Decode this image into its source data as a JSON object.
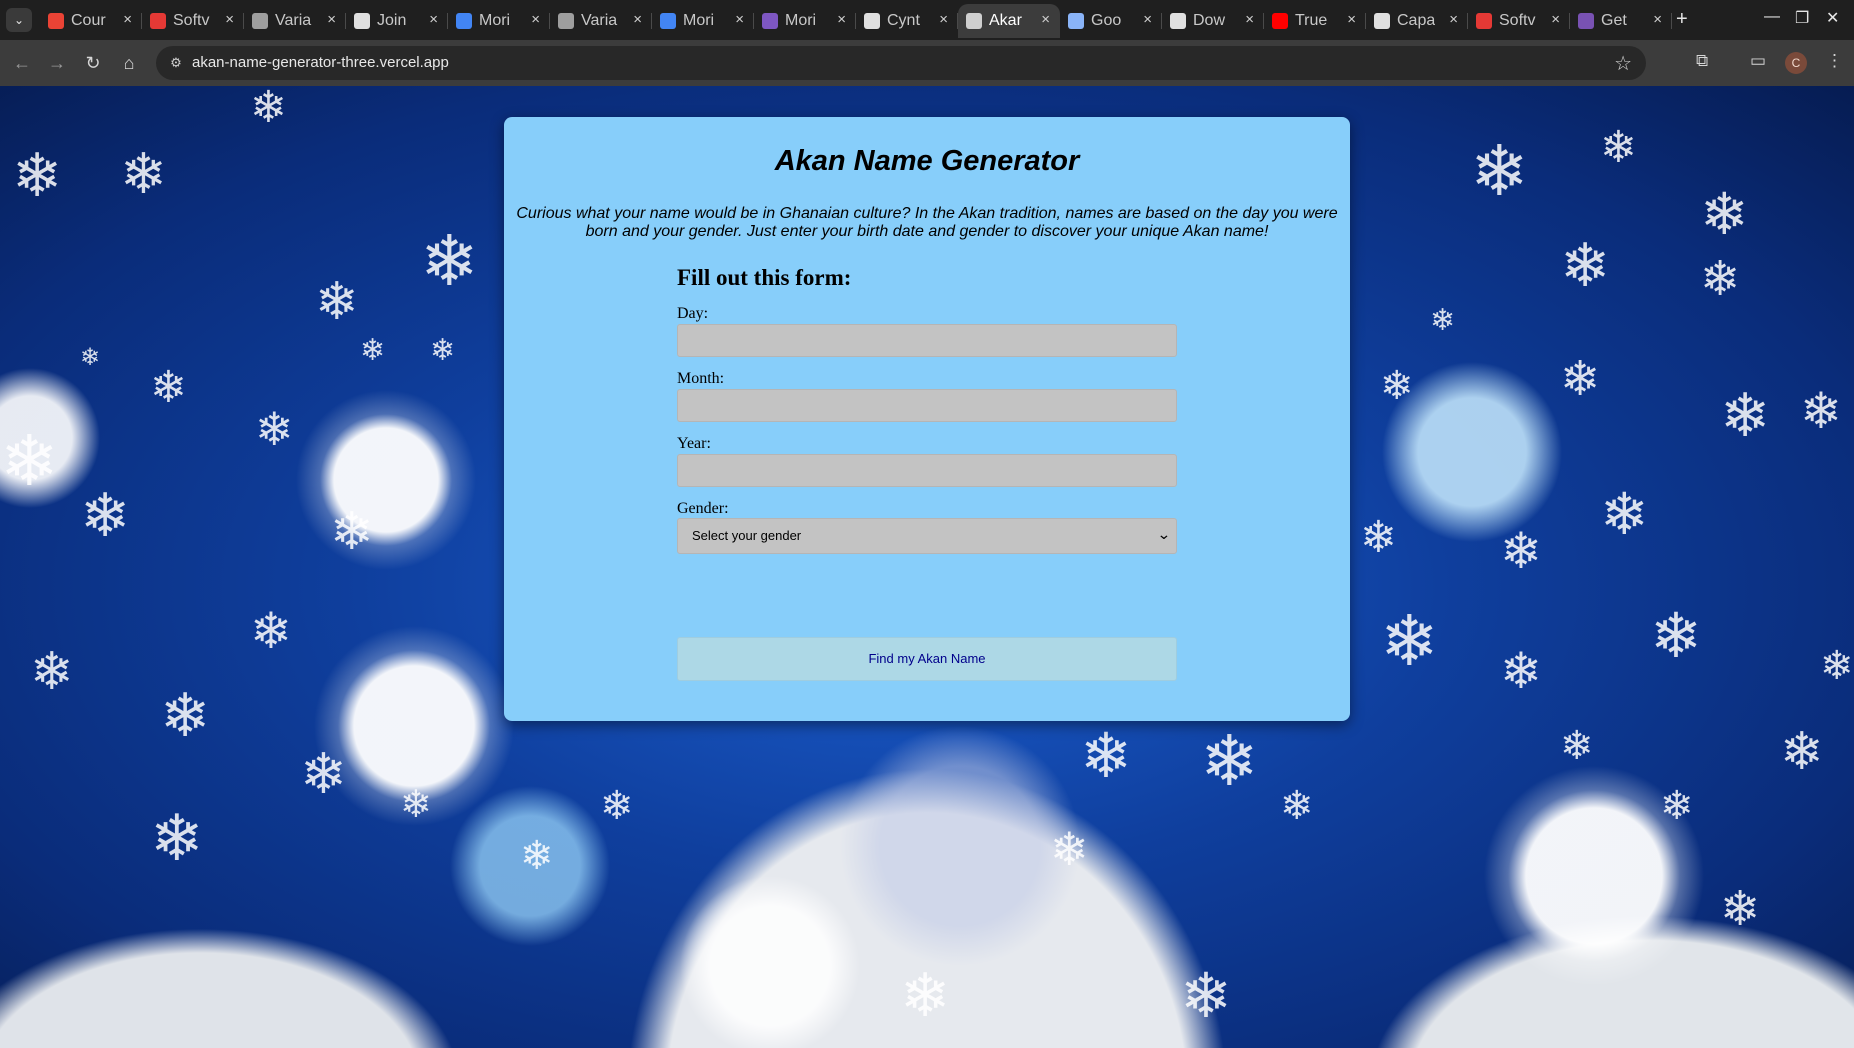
{
  "browser": {
    "tabs": [
      {
        "title": "Cour",
        "favicon": "gmail-icon",
        "color": "#ea4335"
      },
      {
        "title": "Softv",
        "favicon": "spinner-icon",
        "color": "#e53935"
      },
      {
        "title": "Varia",
        "favicon": "image-icon",
        "color": "#9e9e9e"
      },
      {
        "title": "Join",
        "favicon": "quora-icon",
        "color": "#e0e0e0"
      },
      {
        "title": "Mori",
        "favicon": "calendar-icon",
        "color": "#4285f4"
      },
      {
        "title": "Varia",
        "favicon": "image-icon",
        "color": "#9e9e9e"
      },
      {
        "title": "Mori",
        "favicon": "calendar-icon",
        "color": "#4285f4"
      },
      {
        "title": "Mori",
        "favicon": "list-icon",
        "color": "#7e57c2"
      },
      {
        "title": "Cynt",
        "favicon": "github-icon",
        "color": "#e0e0e0"
      },
      {
        "title": "Akar",
        "favicon": "page-icon",
        "color": "#cfcfcf",
        "active": true
      },
      {
        "title": "Goo",
        "favicon": "sparkle-icon",
        "color": "#8ab4f8"
      },
      {
        "title": "Dow",
        "favicon": "download-icon",
        "color": "#e0e0e0"
      },
      {
        "title": "True",
        "favicon": "youtube-icon",
        "color": "#ff0000"
      },
      {
        "title": "Capa",
        "favicon": "chatgpt-icon",
        "color": "#e0e0e0"
      },
      {
        "title": "Softv",
        "favicon": "spinner-icon",
        "color": "#e53935"
      },
      {
        "title": "Get",
        "favicon": "bootstrap-icon",
        "color": "#7952b3"
      }
    ],
    "url": "akan-name-generator-three.vercel.app",
    "profile_initial": "C"
  },
  "page": {
    "title": "Akan Name Generator",
    "intro": "Curious what your name would be in Ghanaian culture? In the Akan tradition, names are based on the day you were born and your gender. Just enter your birth date and gender to discover your unique Akan name!",
    "form": {
      "heading": "Fill out this form:",
      "day_label": "Day:",
      "day_value": "",
      "month_label": "Month:",
      "month_value": "",
      "year_label": "Year:",
      "year_value": "",
      "gender_label": "Gender:",
      "gender_selected": "Select your gender",
      "submit_label": "Find my Akan Name"
    }
  },
  "colors": {
    "card_bg": "#87cefa",
    "input_bg": "#c3c3c3",
    "button_bg": "#add8e6",
    "button_text": "#00008b"
  }
}
